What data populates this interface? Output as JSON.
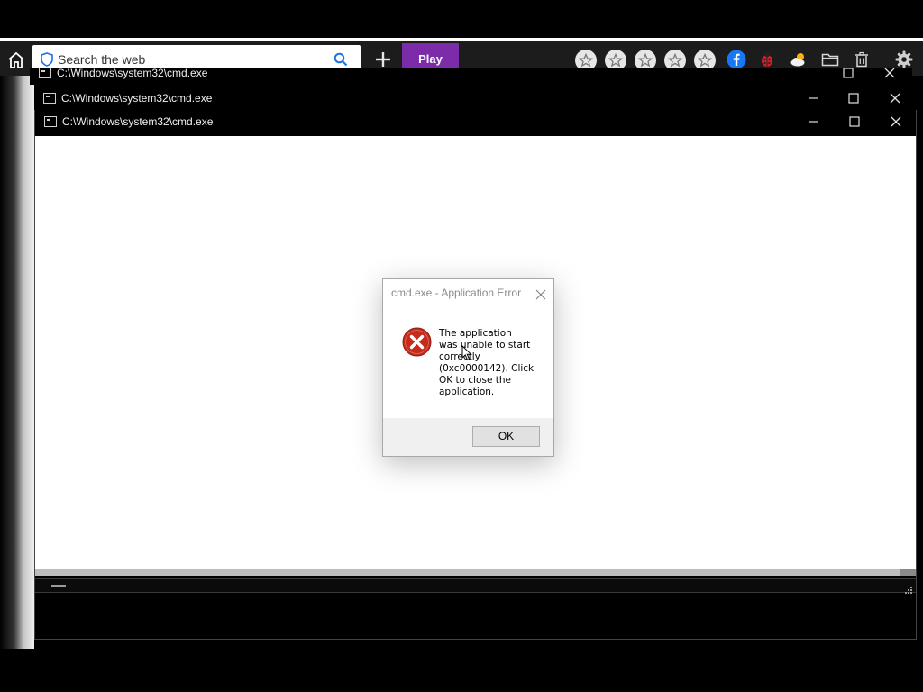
{
  "browser_toolbar": {
    "search": {
      "placeholder": "Search the web"
    },
    "play_label": "Play",
    "favorites": [
      "star-icon",
      "star-icon",
      "star-icon",
      "star-icon",
      "star-icon"
    ],
    "colors": {
      "play_bg": "#7c2ca8",
      "facebook": "#1877f2",
      "toolbar_bg": "#1c1c1c"
    }
  },
  "windows": [
    {
      "title": "C:\\Windows\\system32\\cmd.exe"
    },
    {
      "title": "C:\\Windows\\system32\\cmd.exe"
    },
    {
      "title": "C:\\Windows\\system32\\cmd.exe"
    }
  ],
  "dialog": {
    "title": "cmd.exe - Application Error",
    "message_lines": [
      "The application",
      "was unable to start",
      "correctly",
      "(0xc0000142). Click",
      "OK to close the",
      "application."
    ],
    "ok_label": "OK",
    "icon": "error-icon",
    "colors": {
      "error_red": "#c42b1c"
    }
  }
}
